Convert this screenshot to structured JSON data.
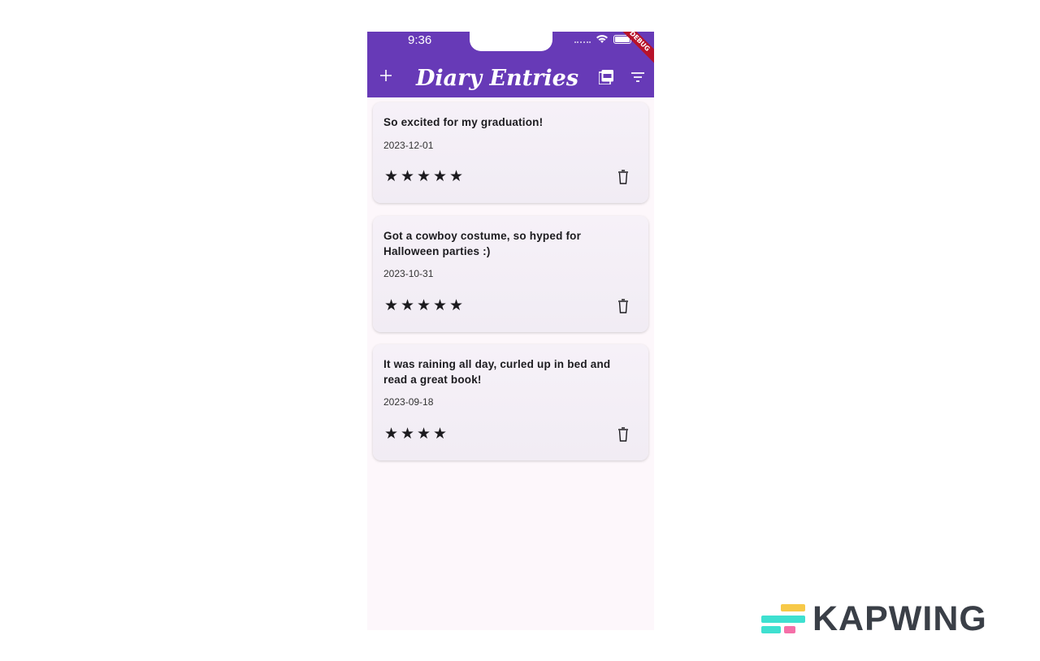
{
  "status_bar": {
    "time": "9:36",
    "debug": "DEBUG"
  },
  "appbar": {
    "title": "Diary Entries",
    "add_icon": "plus-icon",
    "pdf_icon": "pdf-icon",
    "filter_icon": "filter-icon",
    "color": "#673ab7"
  },
  "entries": [
    {
      "text": "So excited for my graduation!",
      "date": "2023-12-01",
      "rating": 5
    },
    {
      "text": "Got a cowboy costume, so hyped for Halloween parties :)",
      "date": "2023-10-31",
      "rating": 5
    },
    {
      "text": "It was raining all day, curled up in bed and read a great book!",
      "date": "2023-09-18",
      "rating": 4
    }
  ],
  "watermark": {
    "text": "KAPWING"
  }
}
